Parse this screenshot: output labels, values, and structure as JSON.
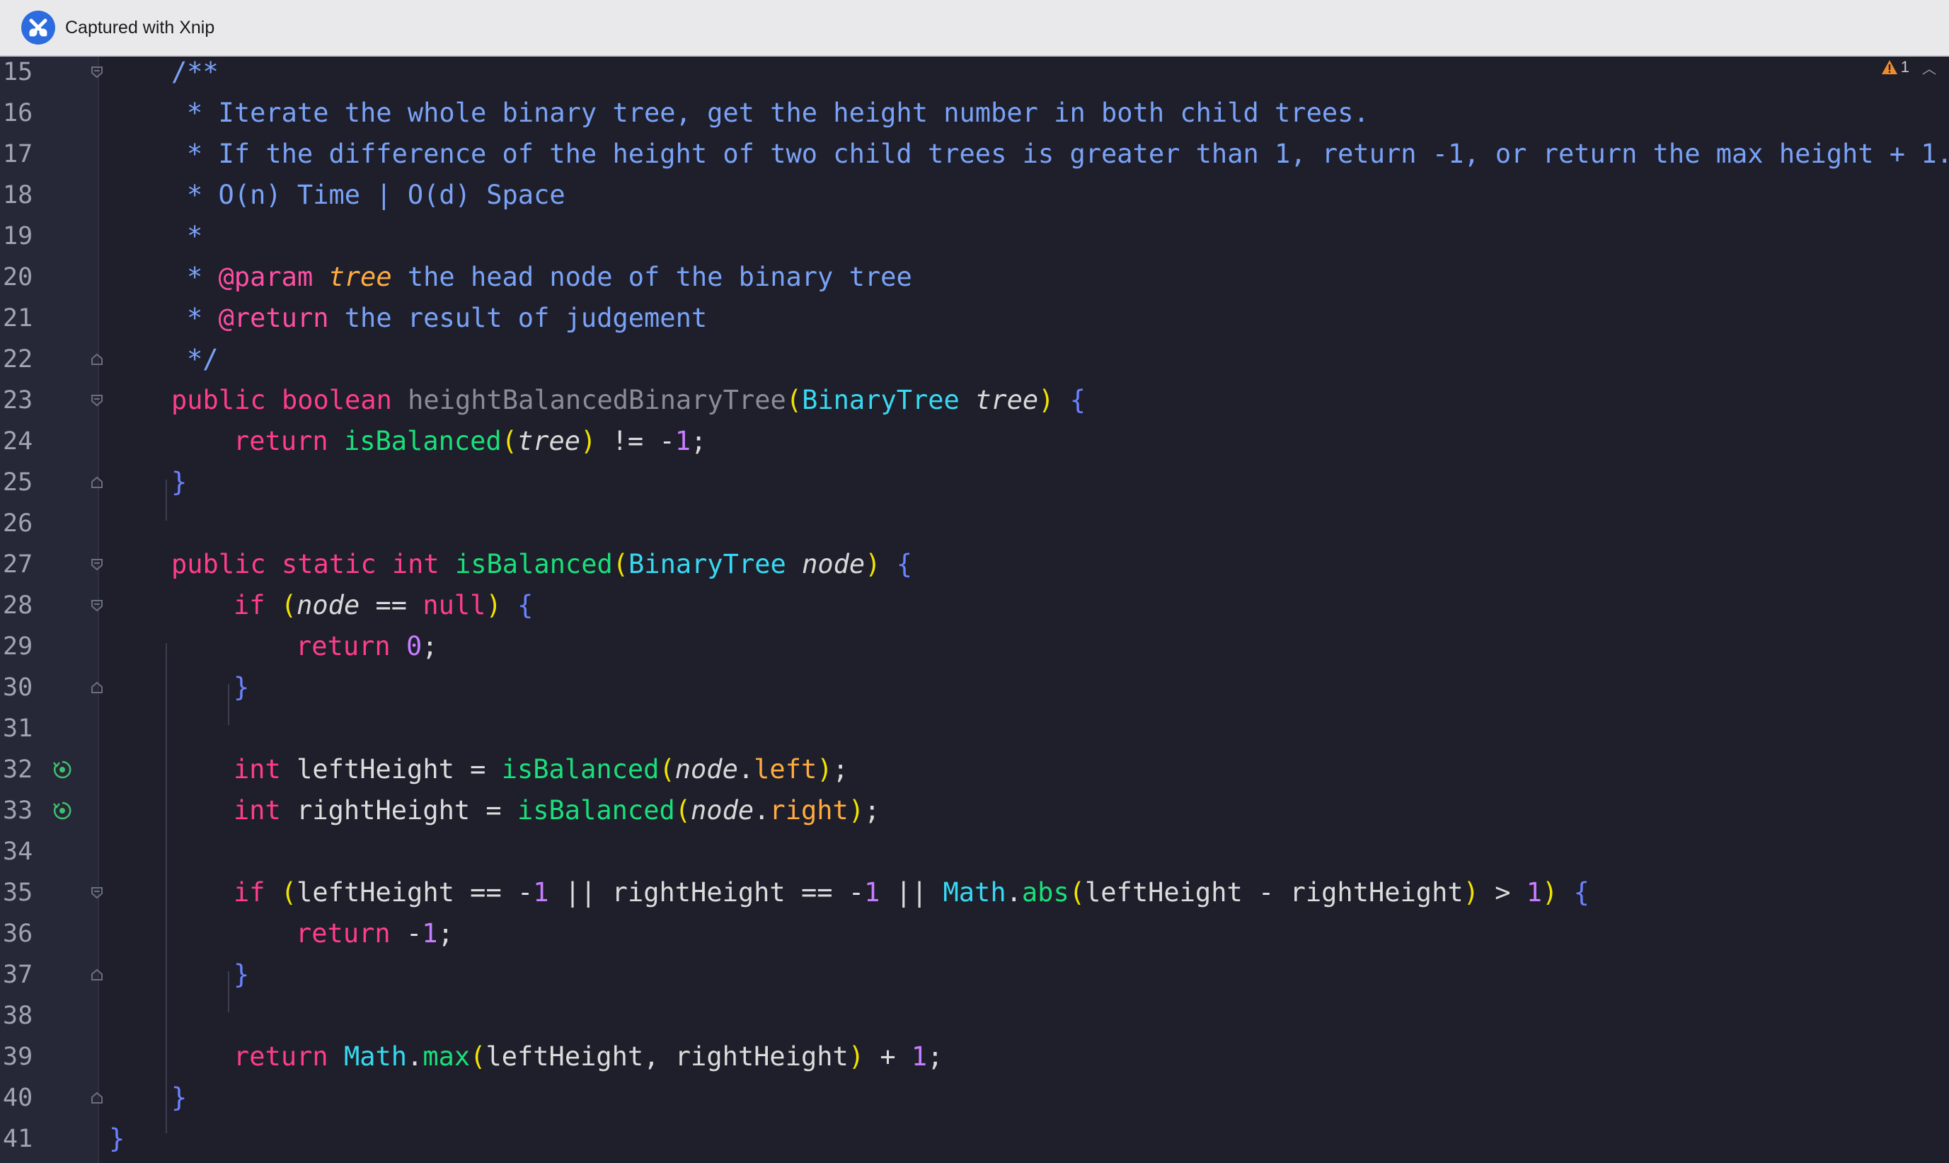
{
  "window": {
    "title": "Captured with Xnip"
  },
  "editor": {
    "warning_count": "1",
    "lines": [
      {
        "n": "15"
      },
      {
        "n": "16"
      },
      {
        "n": "17"
      },
      {
        "n": "18"
      },
      {
        "n": "19"
      },
      {
        "n": "20"
      },
      {
        "n": "21"
      },
      {
        "n": "22"
      },
      {
        "n": "23"
      },
      {
        "n": "24"
      },
      {
        "n": "25"
      },
      {
        "n": "26"
      },
      {
        "n": "27"
      },
      {
        "n": "28"
      },
      {
        "n": "29"
      },
      {
        "n": "30"
      },
      {
        "n": "31"
      },
      {
        "n": "32"
      },
      {
        "n": "33"
      },
      {
        "n": "34"
      },
      {
        "n": "35"
      },
      {
        "n": "36"
      },
      {
        "n": "37"
      },
      {
        "n": "38"
      },
      {
        "n": "39"
      },
      {
        "n": "40"
      },
      {
        "n": "41"
      }
    ],
    "code": {
      "l15": "/**",
      "l16": "* Iterate the whole binary tree, get the height number in both child trees.",
      "l17": "* If the difference of the height of two child trees is greater than 1, return -1, or return the max height + 1.",
      "l18": "* O(n) Time | O(d) Space",
      "l19": "*",
      "l20a": "* ",
      "l20b": "@param",
      "l20c": " ",
      "l20d": "tree",
      "l20e": " the head node of the binary tree",
      "l21a": "* ",
      "l21b": "@return",
      "l21c": " the result of judgement",
      "l22": "*/",
      "public": "public",
      "boolean": "boolean",
      "static": "static",
      "int": "int",
      "return": "return",
      "if": "if",
      "null": "null",
      "fn_hbbt": "heightBalancedBinaryTree",
      "fn_isb": "isBalanced",
      "type_bt": "BinaryTree",
      "type_math": "Math",
      "fn_abs": "abs",
      "fn_max": "max",
      "p_tree": "tree",
      "p_node": "node",
      "f_left": "left",
      "f_right": "right",
      "v_left": "leftHeight",
      "v_right": "rightHeight",
      "n0": "0",
      "n1": "1",
      "lp": "(",
      "rp": ")",
      "lb": "{",
      "rb": "}",
      "semi": ";",
      "neq_m1": " != -",
      "eqeq": " == ",
      "eq": " = ",
      "dot": ".",
      "sp": " ",
      "or": " || ",
      "minus_sign": "-",
      "minus": " - ",
      "gt": " > ",
      "plus": " + ",
      "comma": ", "
    }
  }
}
